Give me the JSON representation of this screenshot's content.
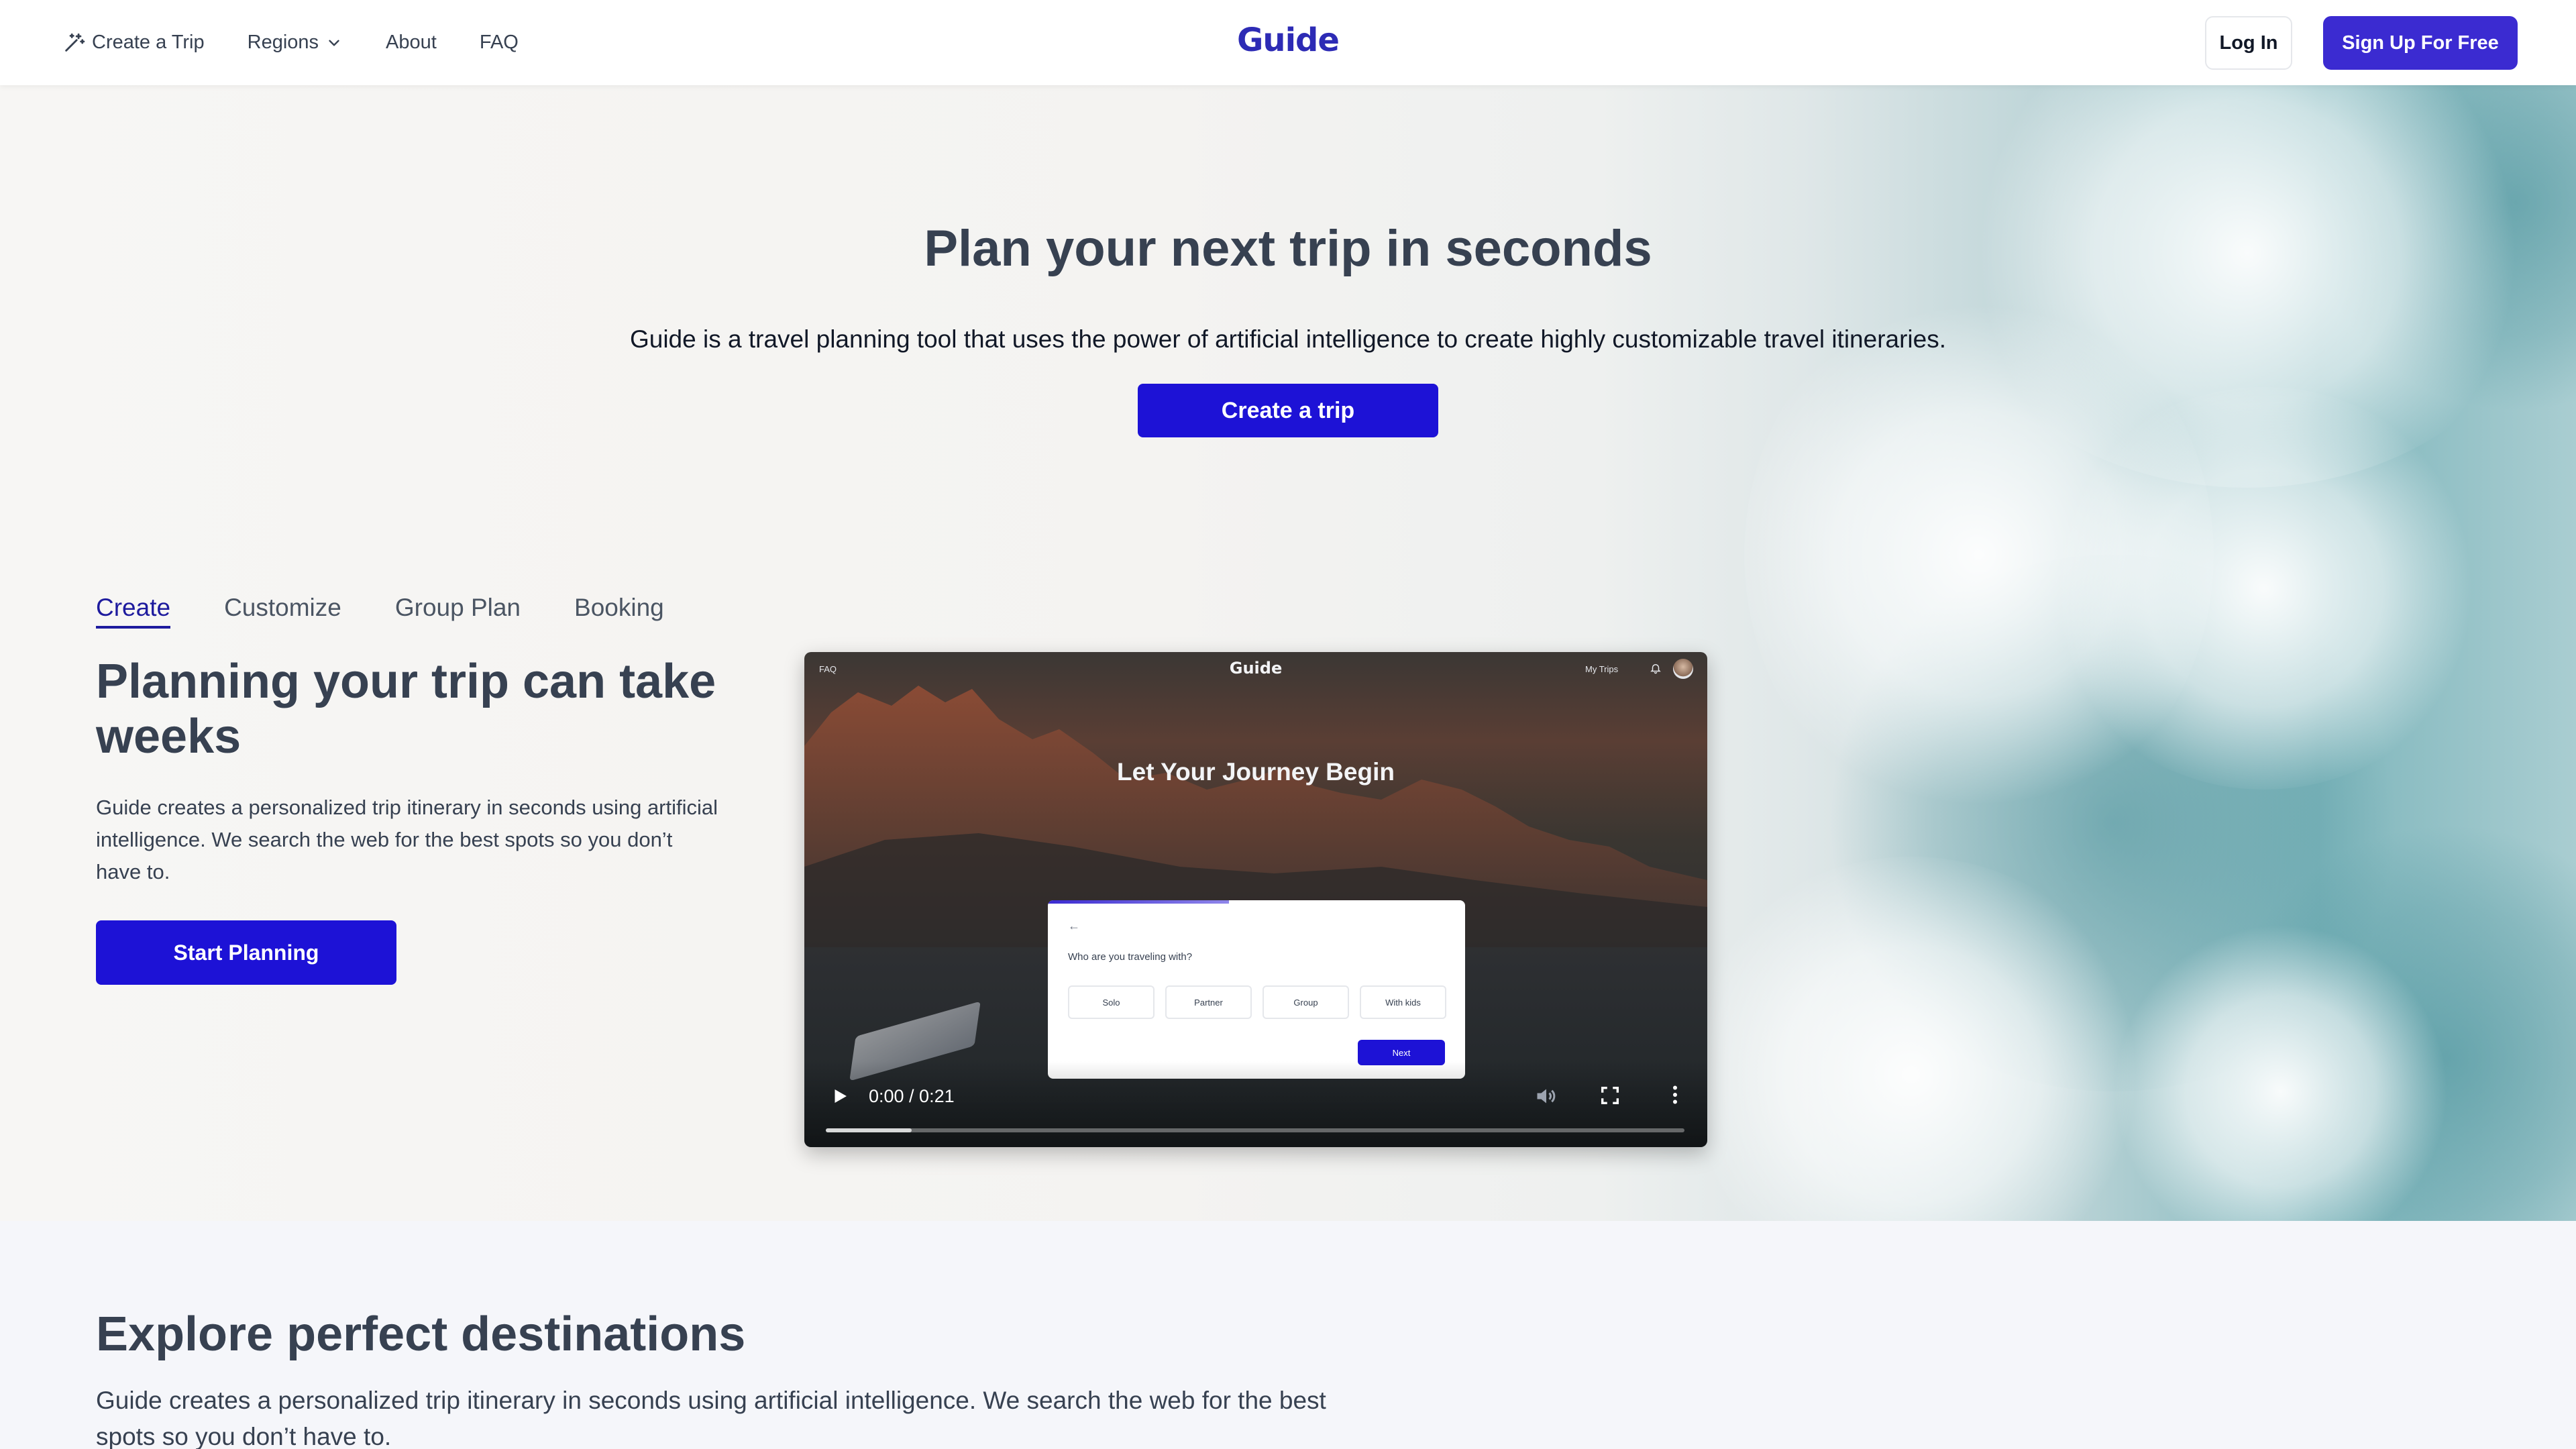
{
  "nav": {
    "create_trip": "Create a Trip",
    "regions": "Regions",
    "about": "About",
    "faq": "FAQ",
    "logo": "Guide",
    "login": "Log In",
    "signup": "Sign Up For Free"
  },
  "hero": {
    "title_regular": "Plan your next trip ",
    "title_bold": "in seconds",
    "subtitle": "Guide is a travel planning tool that uses the power of artificial intelligence to create highly customizable travel itineraries.",
    "cta": "Create a trip"
  },
  "features": {
    "tabs": [
      {
        "label": "Create",
        "active": true
      },
      {
        "label": "Customize",
        "active": false
      },
      {
        "label": "Group Plan",
        "active": false
      },
      {
        "label": "Booking",
        "active": false
      }
    ],
    "title": "Planning your trip can take weeks",
    "text": "Guide creates a personalized trip itinerary in seconds using artificial intelligence. We search the web for the best spots so you don’t have to.",
    "cta": "Start Planning"
  },
  "video": {
    "faq": "FAQ",
    "logo": "Guide",
    "my_trips": "My Trips",
    "headline": "Let Your Journey Begin",
    "question": "Who are you traveling with?",
    "options": [
      "Solo",
      "Partner",
      "Group",
      "With kids"
    ],
    "next": "Next",
    "time": "0:00 / 0:21",
    "buffered_fraction": 0.1
  },
  "explore": {
    "title": "Explore perfect destinations",
    "text": "Guide creates a personalized trip itinerary in seconds using artificial intelligence. We search the web for the best spots so you don’t have to."
  },
  "colors": {
    "brand": "#1d12d6",
    "logo": "#2d2bb5",
    "signup": "#3b2bd1"
  },
  "icons": [
    "magic-wand-icon",
    "chevron-down-icon",
    "play-icon",
    "volume-icon",
    "fullscreen-icon",
    "more-vert-icon",
    "bell-icon",
    "back-arrow-icon"
  ]
}
